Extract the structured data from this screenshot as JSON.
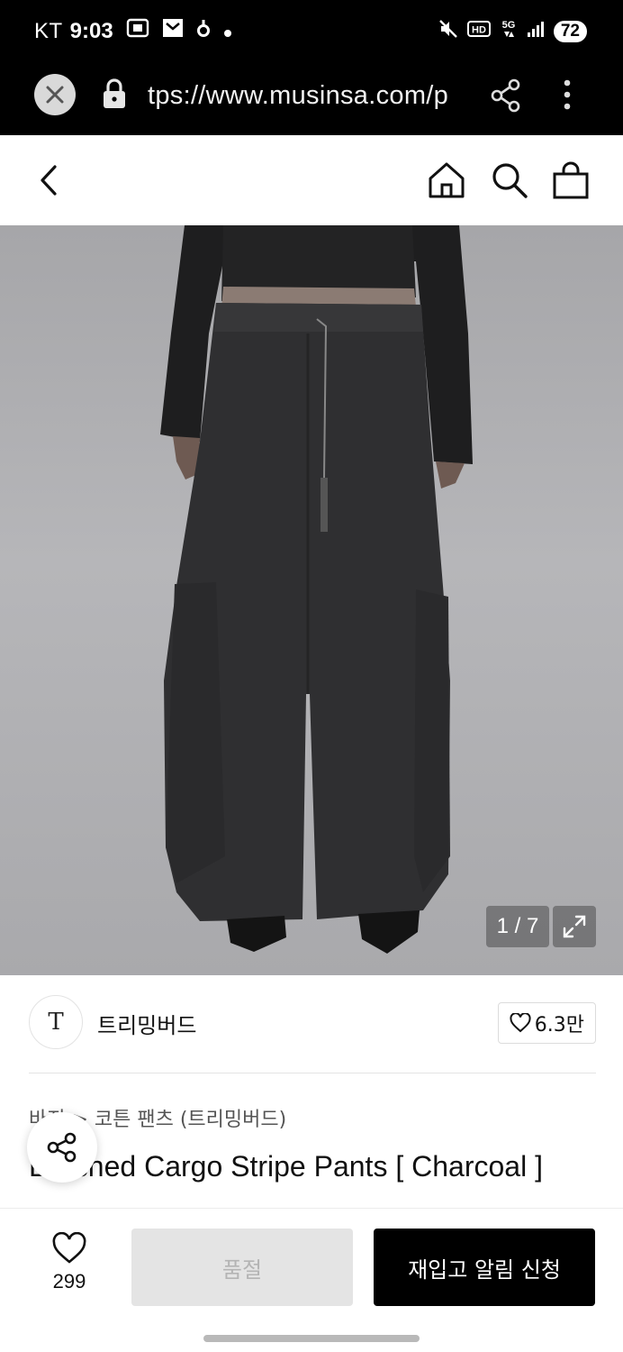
{
  "status_bar": {
    "carrier": "KT",
    "time": "9:03",
    "battery": "72",
    "network": "5G"
  },
  "browser": {
    "url": "tps://www.musinsa.com/p"
  },
  "product": {
    "image_counter": "1 / 7",
    "brand": {
      "logo_text": "T",
      "name": "트리밍버드",
      "likes": "6.3만"
    },
    "breadcrumb": "바지  >  코튼 팬츠 (트리밍버드)",
    "title": "Brushed Cargo Stripe Pants [ Charcoal ]"
  },
  "bottom_bar": {
    "wish_count": "299",
    "soldout_label": "품절",
    "restock_label": "재입고 알림 신청"
  },
  "colors": {
    "status_bg": "#000000",
    "primary_button": "#000000",
    "disabled_button": "#e4e4e4"
  }
}
